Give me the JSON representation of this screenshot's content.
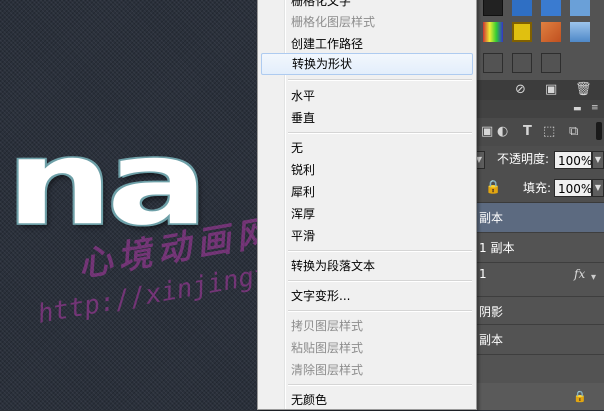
{
  "canvas": {
    "big_text": "na",
    "watermark_cn": "心境动画网",
    "watermark_url": "http://xinjingtk.com/"
  },
  "menu": {
    "items": [
      {
        "label": "栅格化文字",
        "disabled": false
      },
      {
        "label": "栅格化图层样式",
        "disabled": true
      },
      {
        "label": "创建工作路径",
        "disabled": false
      },
      {
        "label": "转换为形状",
        "disabled": false,
        "highlighted": true
      },
      {
        "label": "水平",
        "disabled": false
      },
      {
        "label": "垂直",
        "disabled": false
      },
      {
        "label": "无",
        "disabled": false
      },
      {
        "label": "锐利",
        "disabled": false
      },
      {
        "label": "犀利",
        "disabled": false
      },
      {
        "label": "浑厚",
        "disabled": false
      },
      {
        "label": "平滑",
        "disabled": false
      },
      {
        "label": "转换为段落文本",
        "disabled": false
      },
      {
        "label": "文字变形...",
        "disabled": false
      },
      {
        "label": "拷贝图层样式",
        "disabled": true
      },
      {
        "label": "粘贴图层样式",
        "disabled": true
      },
      {
        "label": "清除图层样式",
        "disabled": true
      },
      {
        "label": "无颜色",
        "disabled": false
      }
    ]
  },
  "panel": {
    "opacity_label": "不透明度:",
    "opacity_value": "100%",
    "fill_label": "填充:",
    "fill_value": "100%",
    "layers": [
      {
        "name": "副本",
        "selected": true
      },
      {
        "name": "1 副本",
        "selected": false
      },
      {
        "name": "1",
        "selected": false,
        "fx": "fx"
      },
      {
        "name": "阴影",
        "selected": false
      },
      {
        "name": "副本",
        "selected": false
      }
    ],
    "colors": {
      "selected_layer": "#5c6a80",
      "swatches": [
        "#2f6fc4",
        "#3a7bd0",
        "#d06a30",
        "#e0b020",
        "#c08040",
        "#6aa0d8"
      ]
    }
  }
}
